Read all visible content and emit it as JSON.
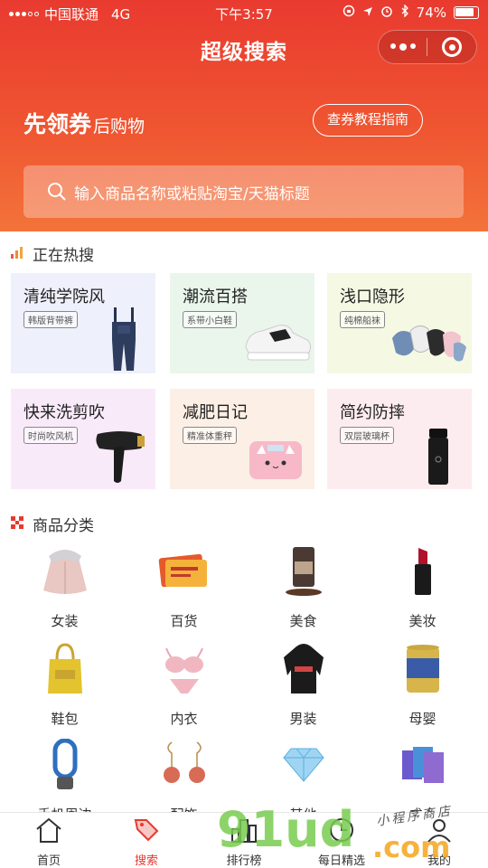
{
  "status_bar": {
    "carrier": "中国联通",
    "network": "4G",
    "time": "下午3:57",
    "battery": "74%"
  },
  "nav": {
    "title": "超级搜索"
  },
  "banner": {
    "slogan_big": "先领券",
    "slogan_small": "后购物",
    "guide_button": "查券教程指南"
  },
  "search": {
    "placeholder": "输入商品名称或粘贴淘宝/天猫标题"
  },
  "hot_section": {
    "title": "正在热搜",
    "items": [
      {
        "title": "清纯学院风",
        "tag": "韩版背带裤",
        "bg": "#eef0fb"
      },
      {
        "title": "潮流百搭",
        "tag": "系带小白鞋",
        "bg": "#eaf6ec"
      },
      {
        "title": "浅口隐形",
        "tag": "纯棉船袜",
        "bg": "#f5f8e3"
      },
      {
        "title": "快来洗剪吹",
        "tag": "时尚吹风机",
        "bg": "#f9eafa"
      },
      {
        "title": "减肥日记",
        "tag": "精准体重秤",
        "bg": "#fcefe5"
      },
      {
        "title": "简约防摔",
        "tag": "双层玻璃杯",
        "bg": "#fdecef"
      }
    ]
  },
  "category_section": {
    "title": "商品分类",
    "items": [
      {
        "label": "女装"
      },
      {
        "label": "百货"
      },
      {
        "label": "美食"
      },
      {
        "label": "美妆"
      },
      {
        "label": "鞋包"
      },
      {
        "label": "内衣"
      },
      {
        "label": "男装"
      },
      {
        "label": "母婴"
      },
      {
        "label": "手机周边"
      },
      {
        "label": "配饰"
      },
      {
        "label": "其他"
      },
      {
        "label": "成人"
      }
    ]
  },
  "tabbar": {
    "items": [
      {
        "label": "首页"
      },
      {
        "label": "搜索"
      },
      {
        "label": "排行榜"
      },
      {
        "label": "每日精选"
      },
      {
        "label": "我的"
      }
    ]
  },
  "watermark": {
    "main": "91ud",
    "suffix": ".com",
    "script": "小程序商店"
  },
  "colors": {
    "accent": "#e8392f",
    "header_top": "#e93a30",
    "header_bottom": "#f3733a"
  }
}
